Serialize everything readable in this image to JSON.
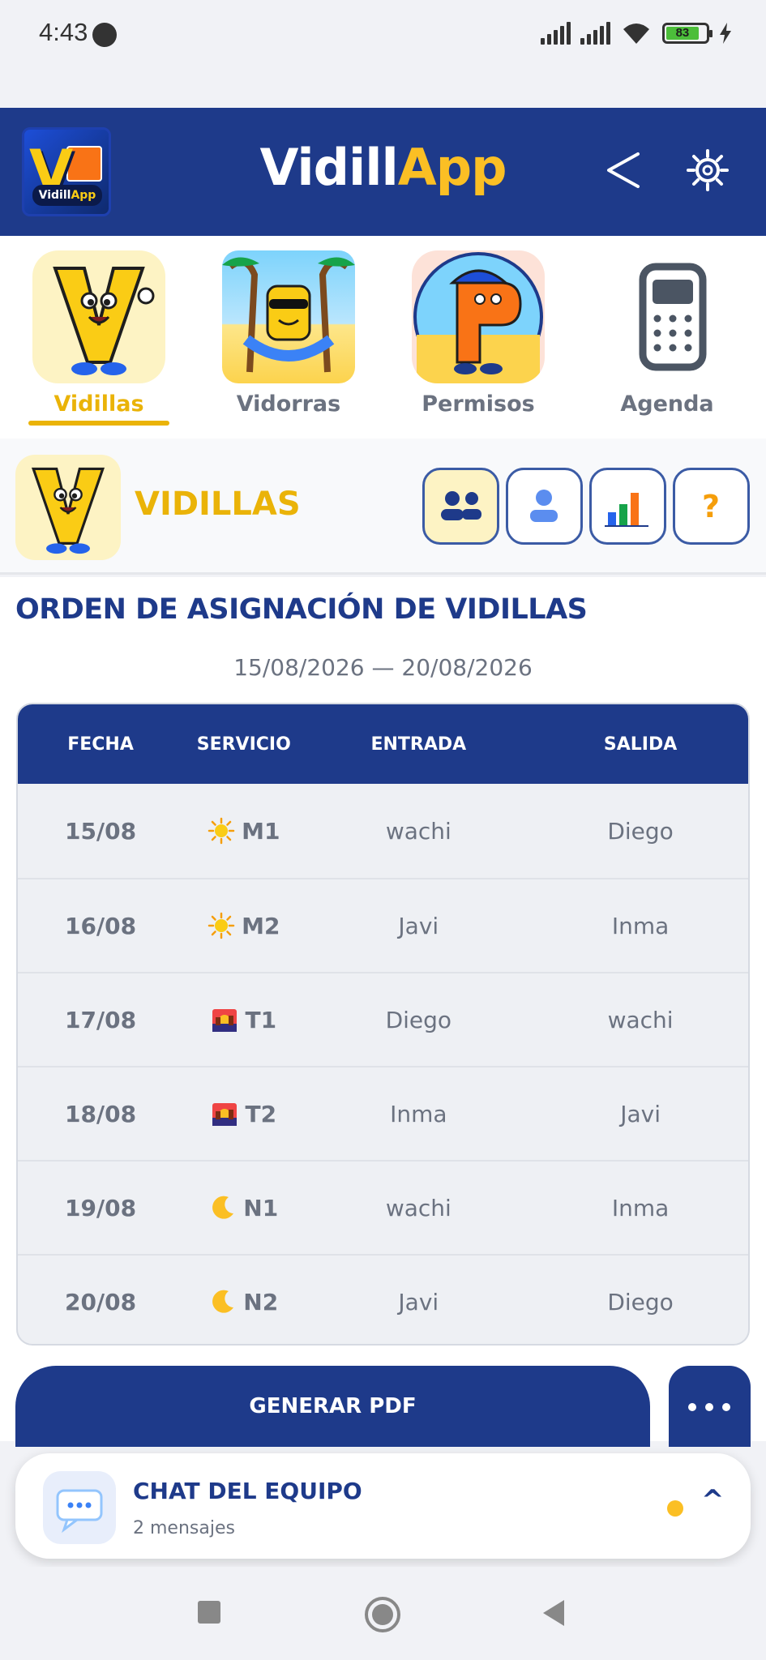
{
  "status": {
    "time": "4:43",
    "battery": "83"
  },
  "header": {
    "title_a": "Vidill",
    "title_b": "App",
    "logo_text_a": "Vidill",
    "logo_text_b": "App"
  },
  "tabs": [
    {
      "label": "Vidillas",
      "active": true
    },
    {
      "label": "Vidorras",
      "active": false
    },
    {
      "label": "Permisos",
      "active": false
    },
    {
      "label": "Agenda",
      "active": false
    }
  ],
  "section": {
    "title": "VIDILLAS"
  },
  "main": {
    "title": "ORDEN DE ASIGNACIÓN DE VIDILLAS",
    "date_range": "15/08/2026 — 20/08/2026",
    "columns": [
      "FECHA",
      "SERVICIO",
      "ENTRADA",
      "SALIDA"
    ],
    "rows": [
      {
        "date": "15/08",
        "icon": "sun-icon",
        "service": "M1",
        "in": "wachi",
        "out": "Diego"
      },
      {
        "date": "16/08",
        "icon": "sun-icon",
        "service": "M2",
        "in": "Javi",
        "out": "Inma"
      },
      {
        "date": "17/08",
        "icon": "sunset-icon",
        "service": "T1",
        "in": "Diego",
        "out": "wachi"
      },
      {
        "date": "18/08",
        "icon": "sunset-icon",
        "service": "T2",
        "in": "Inma",
        "out": "Javi"
      },
      {
        "date": "19/08",
        "icon": "moon-icon",
        "service": "N1",
        "in": "wachi",
        "out": "Inma"
      },
      {
        "date": "20/08",
        "icon": "moon-icon",
        "service": "N2",
        "in": "Javi",
        "out": "Diego"
      }
    ],
    "pdf_button": "GENERAR PDF"
  },
  "chat": {
    "title": "CHAT DEL EQUIPO",
    "subtitle": "2 mensajes",
    "caret": "^"
  },
  "colors": {
    "primary": "#1e3a8a",
    "accent": "#eab308",
    "tile_bg": "#fdf3c4"
  }
}
